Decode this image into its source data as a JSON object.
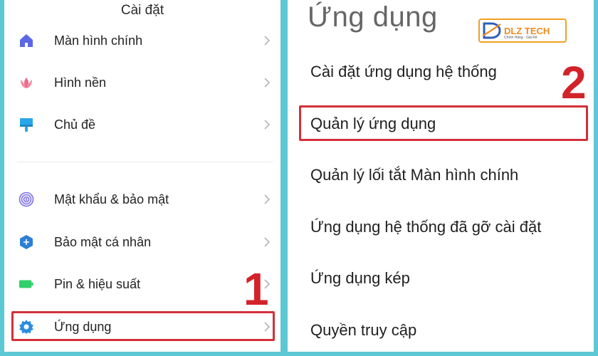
{
  "left": {
    "title": "Cài đặt",
    "items": [
      {
        "label": "Màn hình chính",
        "icon": "home-icon",
        "color": "#5b67e6"
      },
      {
        "label": "Hình nền",
        "icon": "flower-icon",
        "color": "#f06a8a"
      },
      {
        "label": "Chủ đề",
        "icon": "brush-icon",
        "color": "#2aa6e8"
      },
      {
        "label": "Mật khẩu & bảo mật",
        "icon": "fingerprint-icon",
        "color": "#7b6ce6"
      },
      {
        "label": "Bảo mật cá nhân",
        "icon": "shield-icon",
        "color": "#2c7fd6"
      },
      {
        "label": "Pin & hiệu suất",
        "icon": "battery-icon",
        "color": "#2fcf6a"
      },
      {
        "label": "Ứng dụng",
        "icon": "gear-icon",
        "color": "#2a8de0"
      }
    ],
    "step": "1"
  },
  "right": {
    "title": "Ứng dụng",
    "items": [
      {
        "label": "Cài đặt ứng dụng hệ thống"
      },
      {
        "label": "Quản lý ứng dụng"
      },
      {
        "label": "Quản lý lối tắt Màn hình chính"
      },
      {
        "label": "Ứng dụng hệ thống đã gỡ cài đặt"
      },
      {
        "label": "Ứng dụng kép"
      },
      {
        "label": "Quyền truy cập"
      }
    ],
    "step": "2"
  },
  "logo": {
    "name": "DLZ TECH",
    "tagline": "Chính Hãng · Giá Rẻ",
    "accent": "#f08a1c"
  },
  "colors": {
    "background": "#5cc8d3",
    "highlight": "#d2303a"
  }
}
